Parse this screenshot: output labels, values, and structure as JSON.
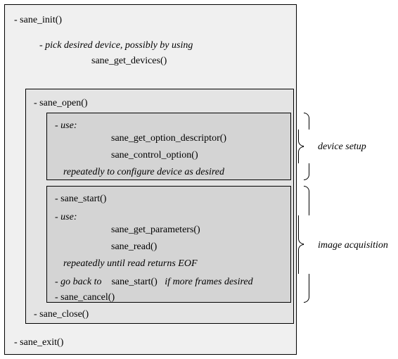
{
  "outer": {
    "init": "- sane_init()",
    "pick_device_1": "- pick desired device, possibly by using",
    "pick_device_fn": "sane_get_devices()",
    "exit": "- sane_exit()"
  },
  "open_box": {
    "open": "- sane_open()",
    "close": "- sane_close()"
  },
  "device_setup_box": {
    "use": "- use:",
    "fn1": "sane_get_option_descriptor()",
    "fn2": "sane_control_option()",
    "note": "repeatedly to configure device as desired"
  },
  "image_acq_box": {
    "start": "- sane_start()",
    "use": "- use:",
    "fn1": "sane_get_parameters()",
    "fn2": "sane_read()",
    "note": "repeatedly until read returns EOF",
    "goback_pre": "- go back to",
    "goback_fn": "sane_start()",
    "goback_post": "if more frames desired",
    "cancel": "- sane_cancel()"
  },
  "labels": {
    "device_setup": "device setup",
    "image_acquisition": "image acquisition"
  },
  "colors": {
    "bg_outer": "#f0f0f0",
    "bg_mid": "#e4e4e4",
    "bg_inner": "#d4d4d4"
  }
}
